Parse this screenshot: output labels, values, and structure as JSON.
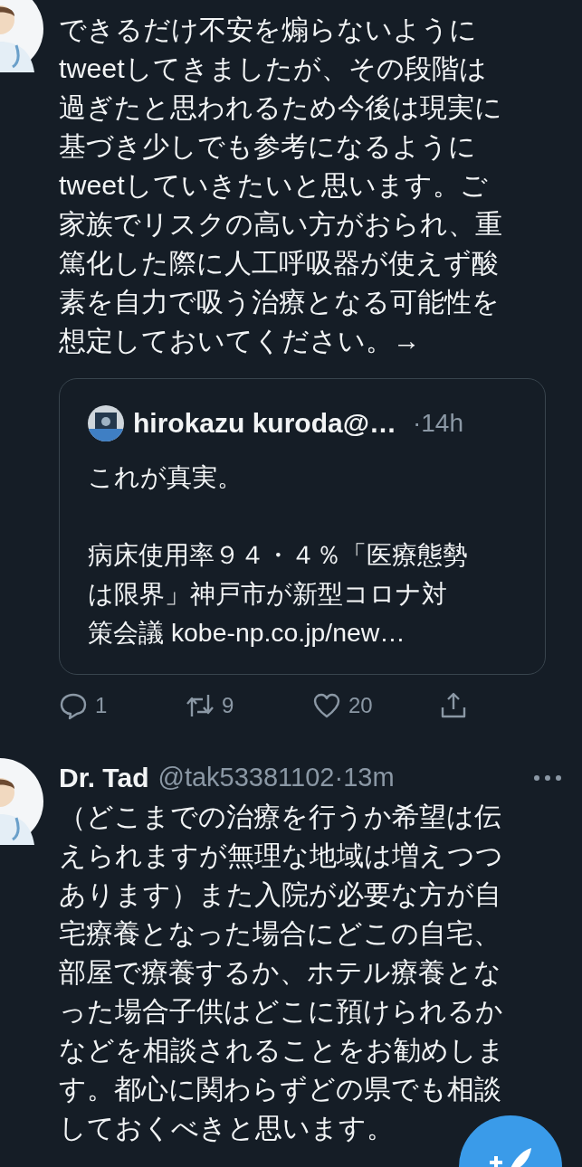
{
  "tweets": [
    {
      "text": "できるだけ不安を煽らないようにtweetしてきましたが、その段階は過ぎたと思われるため今後は現実に基づき少しでも参考になるようにtweetしていきたいと思います。ご家族でリスクの高い方がおられ、重篤化した際に人工呼吸器が使えず酸素を自力で吸う治療となる可能性を想定しておいてください。→",
      "quote": {
        "author": "hirokazu kuroda@…",
        "time": "·14h",
        "paragraphs": [
          "これが真実。",
          "病床使用率９４・４％「医療態勢は限界」神戸市が新型コロナ対策会議 kobe-np.co.jp/new…"
        ]
      },
      "actions": [
        {
          "kind": "reply",
          "count": "1"
        },
        {
          "kind": "retweet",
          "count": "9"
        },
        {
          "kind": "like",
          "count": "20"
        },
        {
          "kind": "share"
        }
      ]
    },
    {
      "author": "Dr. Tad",
      "handle": "@tak53381102",
      "time": "·13m",
      "text": "（どこまでの治療を行うか希望は伝えられますが無理な地域は増えつつあります）また入院が必要な方が自宅療養となった場合にどこの自宅、部屋で療養するか、ホテル療養となった場合子供はどこに預けられるかなどを相談されることをお勧めします。都心に関わらずどの県でも相談しておくべきと思います。"
    }
  ]
}
